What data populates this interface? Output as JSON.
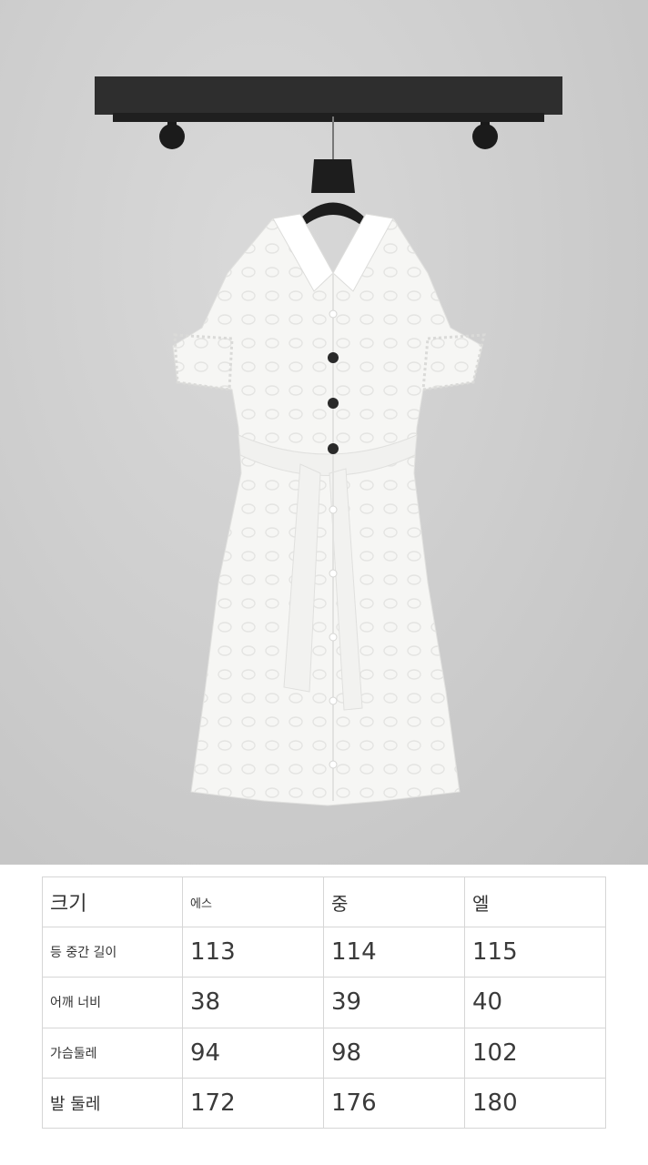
{
  "photo": {
    "subject": "white short-sleeve belted shirt dress on hanger"
  },
  "size_table": {
    "headers": [
      "크기",
      "에스",
      "중",
      "엘"
    ],
    "rows": [
      {
        "label": "등 중간 길이",
        "values": [
          "113",
          "114",
          "115"
        ]
      },
      {
        "label": "어깨 너비",
        "values": [
          "38",
          "39",
          "40"
        ]
      },
      {
        "label": "가슴둘레",
        "values": [
          "94",
          "98",
          "102"
        ]
      },
      {
        "label": "발 둘레",
        "values": [
          "172",
          "176",
          "180"
        ]
      }
    ]
  },
  "colors": {
    "wall": "#cfcfcf",
    "shelf": "#2e2e2e",
    "dress": "#f6f6f4",
    "grid": "#d6d6d6"
  }
}
